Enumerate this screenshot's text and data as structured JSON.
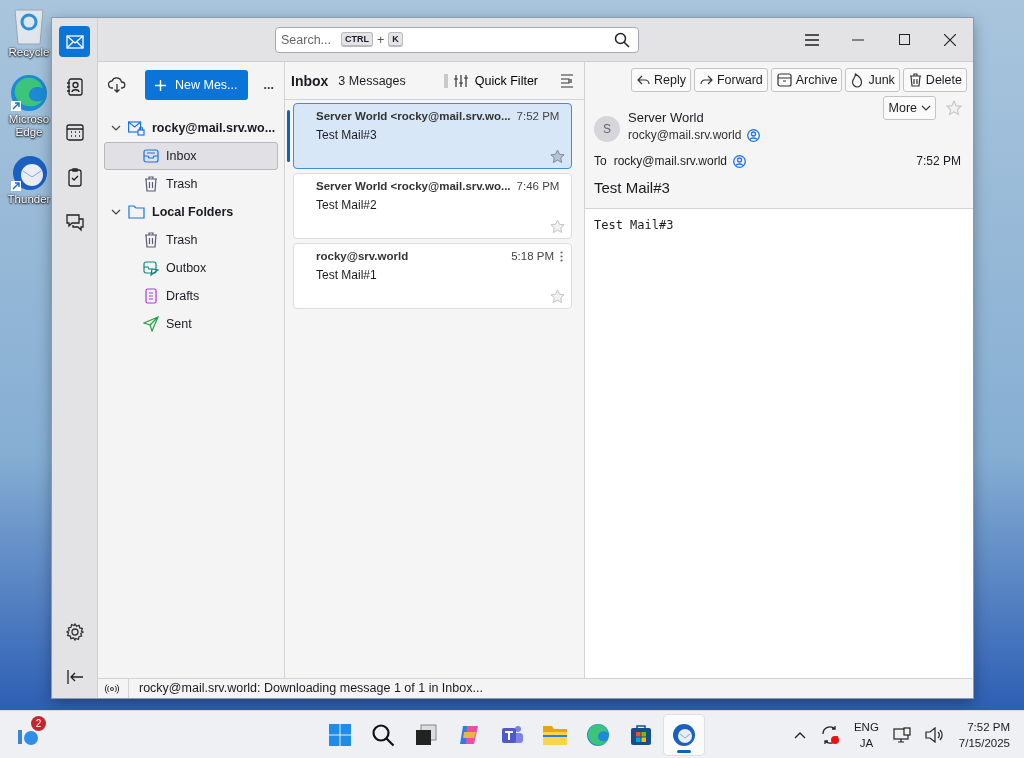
{
  "desktop_icons": [
    {
      "kind": "recycle",
      "lines": [
        "Recycle"
      ]
    },
    {
      "kind": "edge",
      "lines": [
        "Microso",
        "Edge"
      ]
    },
    {
      "kind": "thunderbird",
      "lines": [
        "Thunder"
      ]
    }
  ],
  "rail": [
    {
      "kind": "mail",
      "selected": true
    },
    {
      "kind": "contacts",
      "selected": false
    },
    {
      "kind": "calendar",
      "selected": false
    },
    {
      "kind": "tasks",
      "selected": false
    },
    {
      "kind": "chat",
      "selected": false
    }
  ],
  "search": {
    "placeholder": "Search...",
    "keys": [
      "CTRL",
      "K"
    ],
    "joiner": "+"
  },
  "folder_pane": {
    "new_message": "New Mes...",
    "more": "...",
    "folders": [
      {
        "label": "rocky@mail.srv.wo...",
        "kind": "account",
        "expanded": true,
        "children": [
          {
            "label": "Inbox",
            "kind": "inbox",
            "selected": true
          },
          {
            "label": "Trash",
            "kind": "trash",
            "selected": false
          }
        ]
      },
      {
        "label": "Local Folders",
        "kind": "folder",
        "expanded": true,
        "children": [
          {
            "label": "Trash",
            "kind": "trash",
            "selected": false
          },
          {
            "label": "Outbox",
            "kind": "outbox",
            "selected": false
          },
          {
            "label": "Drafts",
            "kind": "drafts",
            "selected": false
          },
          {
            "label": "Sent",
            "kind": "sent",
            "selected": false
          }
        ]
      }
    ]
  },
  "message_list": {
    "title": "Inbox",
    "count": "3 Messages",
    "quick_filter": "Quick Filter",
    "messages": [
      {
        "sender": "Server World <rocky@mail.srv.wo...",
        "time": "7:52 PM",
        "subject": "Test Mail#3",
        "selected": true
      },
      {
        "sender": "Server World <rocky@mail.srv.wo...",
        "time": "7:46 PM",
        "subject": "Test Mail#2",
        "selected": false
      },
      {
        "sender": "rocky@srv.world",
        "time": "5:18 PM",
        "subject": "Test Mail#1",
        "selected": false
      }
    ]
  },
  "reader": {
    "actions": [
      {
        "label": "Reply",
        "kind": "reply"
      },
      {
        "label": "Forward",
        "kind": "forward"
      },
      {
        "label": "Archive",
        "kind": "archive"
      },
      {
        "label": "Junk",
        "kind": "junk"
      },
      {
        "label": "Delete",
        "kind": "delete"
      }
    ],
    "more": "More",
    "avatar": "S",
    "sender_name": "Server World",
    "sender_email": "rocky@mail.srv.world",
    "to_label": "To",
    "to_address": "rocky@mail.srv.world",
    "time": "7:52 PM",
    "subject": "Test Mail#3",
    "body": "Test Mail#3"
  },
  "status_bar": "rocky@mail.srv.world: Downloading message 1 of 1 in Inbox...",
  "taskbar": {
    "badge": "2",
    "apps": [
      {
        "kind": "start",
        "active": false
      },
      {
        "kind": "search",
        "active": false
      },
      {
        "kind": "taskview",
        "active": false
      },
      {
        "kind": "copilot",
        "active": false
      },
      {
        "kind": "teams",
        "active": false
      },
      {
        "kind": "explorer",
        "active": false
      },
      {
        "kind": "edge",
        "active": false
      },
      {
        "kind": "store",
        "active": false
      },
      {
        "kind": "thunderbird",
        "active": true
      }
    ],
    "language": [
      "ENG",
      "JA"
    ],
    "time": "7:52 PM",
    "date": "7/15/2025"
  }
}
